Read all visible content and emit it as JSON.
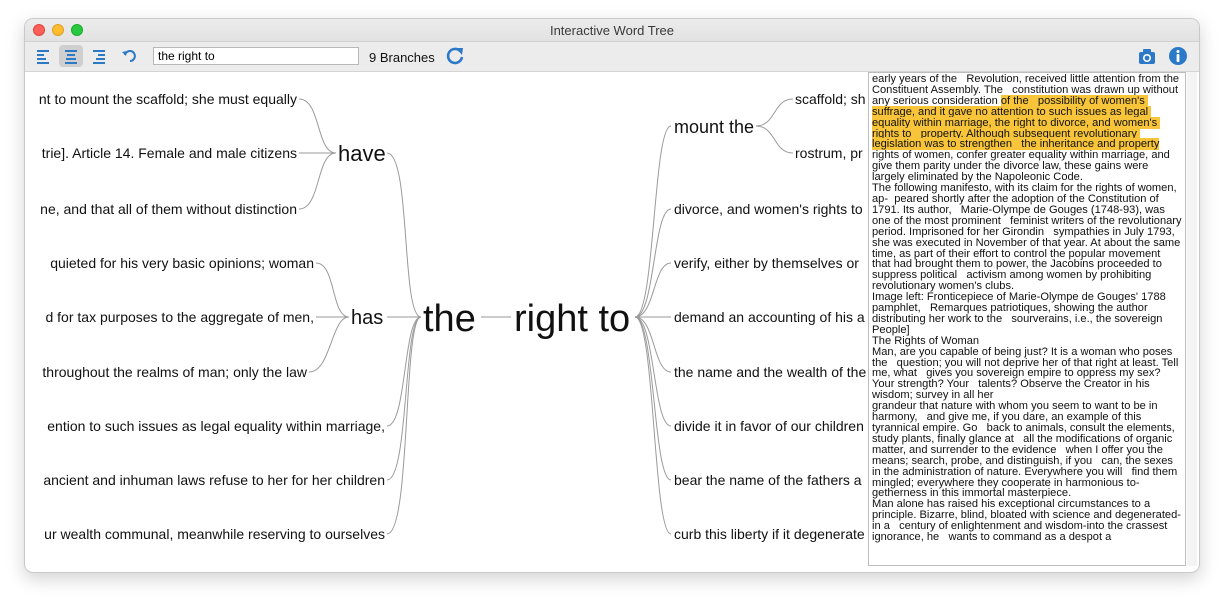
{
  "window": {
    "title": "Interactive Word Tree"
  },
  "toolbar": {
    "search_value": "the right to",
    "branches_label": "9 Branches",
    "icons": [
      "align-left-icon",
      "align-center-icon",
      "align-right-icon",
      "undo-icon",
      "refresh-icon",
      "camera-icon",
      "info-icon"
    ],
    "accent_color": "#2c79c8"
  },
  "tree": {
    "left_root": "the",
    "right_root": "right to",
    "left_mid": [
      "have",
      "has"
    ],
    "left_leaves": [
      "nt to mount the scaffold; she must equally",
      "trie]. Article 14. Female and male citizens",
      "ne, and that all of them without distinction",
      "quieted for his very basic opinions; woman",
      "d for tax purposes to the aggregate of men,",
      "throughout the realms of man; only the law",
      "ention to such issues as legal equality within marriage,",
      "ancient and inhuman laws refuse to her for her children",
      "ur wealth communal, meanwhile reserving to ourselves"
    ],
    "right_mid": "mount the",
    "right_sub": [
      "scaffold; sh",
      "rostrum, pr"
    ],
    "right_leaves": [
      "divorce, and women's rights to",
      "verify, either by themselves or",
      "demand an accounting of his a",
      "the name and the wealth of the",
      "divide it in favor of our children",
      "bear the name of the fathers a",
      "curb this liberty if it degenerate"
    ]
  },
  "text_panel": {
    "highlight_color": "#f8c53a",
    "before": "early years of the   Revolution, received little attention from the Constituent Assembly. The   constitution was drawn up without any serious consideration ",
    "highlight": "of the   possibility of women's suffrage, and it gave no attention to such issues as legal equality within marriage, the right to divorce, and women's rights to   property. Although subsequent revolutionary legislation was to strengthen   the inheritance and property",
    "after": " rights of women, confer greater equality within marriage, and give them parity under the divorce law, these gains were   largely eliminated by the Napoleonic Code.\nThe following manifesto, with its claim for the rights of women, ap-  peared shortly after the adoption of the Constitution of 1791. Its author,   Marie-Olympe de Gouges (1748-93), was one of the most prominent   feminist writers of the revolutionary period. Imprisoned for her Girondin   sympathies in July 1793, she was executed in November of that year. At about the same time, as part of their effort to control the popular movement   that had brought them to power, the Jacobins proceeded to suppress political   activism among women by prohibiting revolutionary women's clubs.\nImage left: Fronticepiece of Marie-Olympe de Gouges' 1788 pamphlet,   Remarques patriotiques, showing the author distributing her work to the   sourverains, i.e., the sovereign People]\nThe Rights of Woman\nMan, are you capable of being just? It is a woman who poses the   question; you will not deprive her of that right at least. Tell me, what   gives you sovereign empire to oppress my sex? Your strength? Your   talents? Observe the Creator in his wisdom; survey in all her\ngrandeur that nature with whom you seem to want to be in harmony,   and give me, if you dare, an example of this tyrannical empire. Go   back to animals, consult the elements, study plants, finally glance at   all the modifications of organic matter, and surrender to the evidence   when I offer you the means; search, probe, and distinguish, if you   can, the sexes in the administration of nature. Everywhere you will   find them mingled; everywhere they cooperate in harmonious to-  getherness in this immortal masterpiece.\nMan alone has raised his exceptional circumstances to a principle. Bizarre, blind, bloated with science and degenerated-in a   century of enlightenment and wisdom-into the crassest ignorance, he   wants to command as a despot a"
  }
}
